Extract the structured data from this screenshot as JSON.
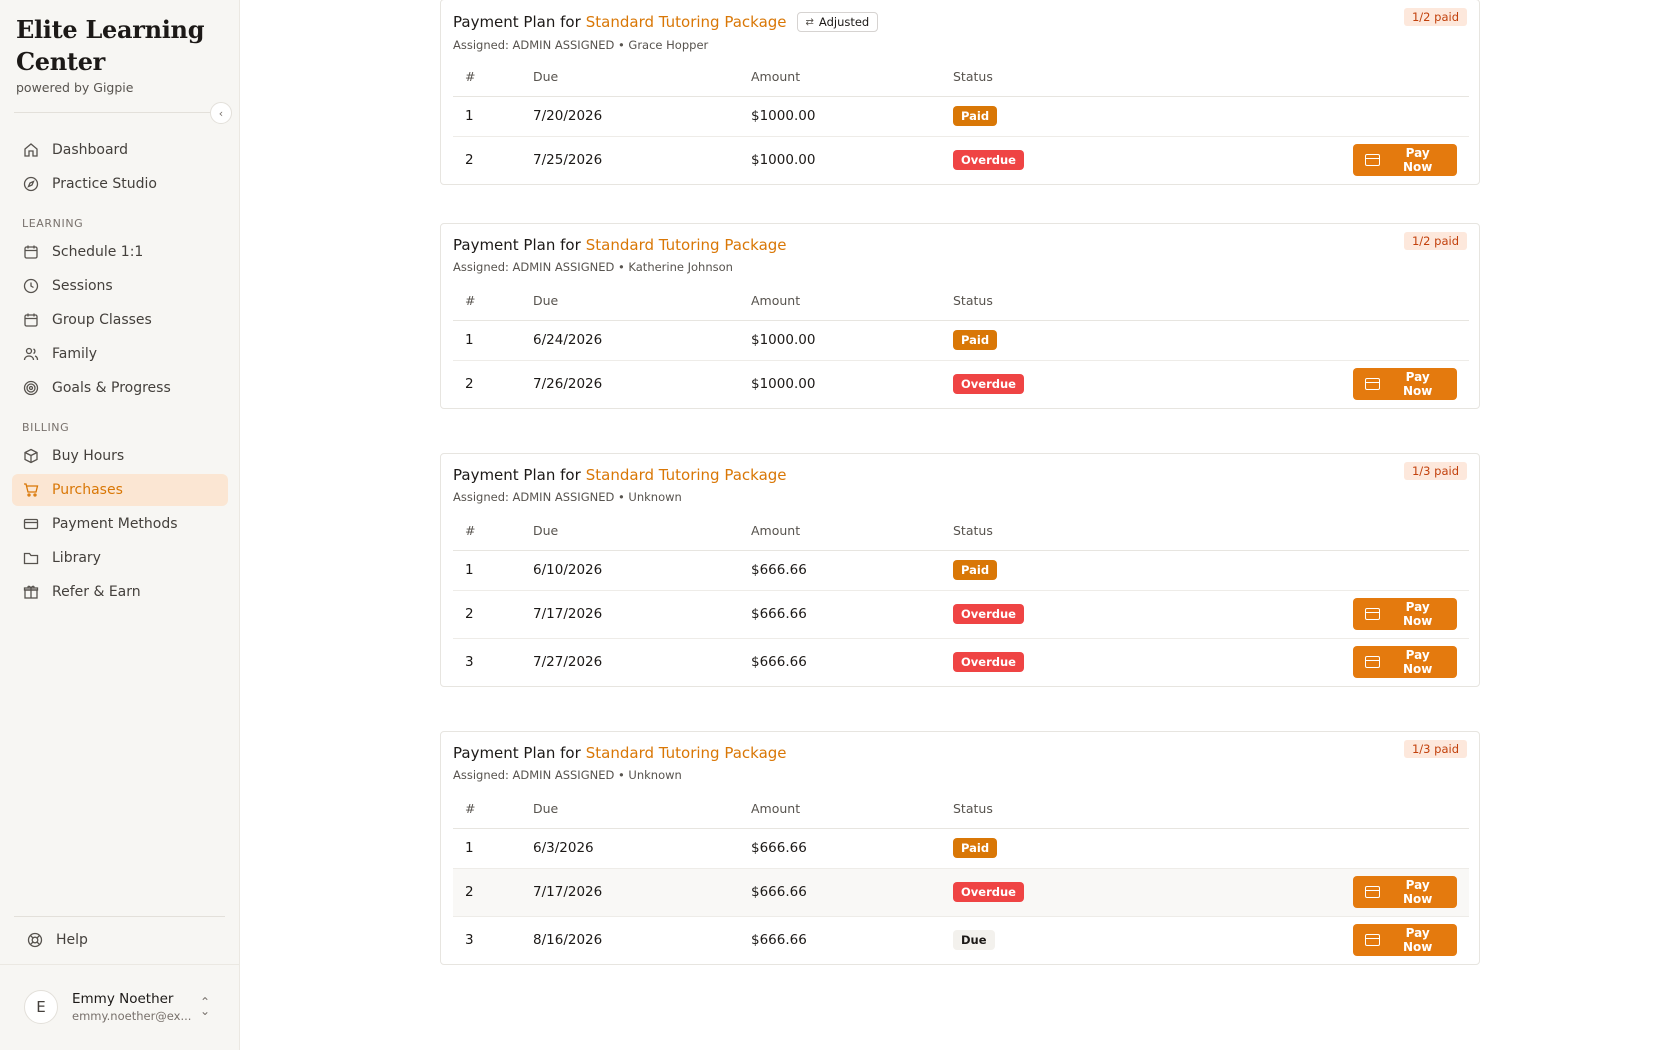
{
  "brand": {
    "name": "Elite Learning Center",
    "powered_by": "powered by Gigpie"
  },
  "nav": {
    "top": [
      {
        "label": "Dashboard",
        "icon": "home-icon"
      },
      {
        "label": "Practice Studio",
        "icon": "compass-icon"
      }
    ],
    "learning_title": "LEARNING",
    "learning": [
      {
        "label": "Schedule 1:1",
        "icon": "calendar-icon"
      },
      {
        "label": "Sessions",
        "icon": "clock-icon"
      },
      {
        "label": "Group Classes",
        "icon": "calendar-icon"
      },
      {
        "label": "Family",
        "icon": "users-icon"
      },
      {
        "label": "Goals & Progress",
        "icon": "target-icon"
      }
    ],
    "billing_title": "BILLING",
    "billing": [
      {
        "label": "Buy Hours",
        "icon": "package-icon"
      },
      {
        "label": "Purchases",
        "icon": "cart-icon",
        "active": true
      },
      {
        "label": "Payment Methods",
        "icon": "credit-card-icon"
      },
      {
        "label": "Library",
        "icon": "folder-icon"
      },
      {
        "label": "Refer & Earn",
        "icon": "gift-icon"
      }
    ],
    "help": "Help"
  },
  "user": {
    "initial": "E",
    "name": "Emmy Noether",
    "email": "emmy.noether@ex..."
  },
  "table_headers": {
    "num": "#",
    "due": "Due",
    "amount": "Amount",
    "status": "Status"
  },
  "plans": [
    {
      "title_prefix": "Payment Plan for",
      "package": "Standard Tutoring Package",
      "adjusted": "Adjusted",
      "assigned": "Assigned: ADMIN ASSIGNED • Grace Hopper",
      "paid_badge": "1/2 paid",
      "rows": [
        {
          "num": "1",
          "due": "7/20/2026",
          "amount": "$1000.00",
          "status": "Paid"
        },
        {
          "num": "2",
          "due": "7/25/2026",
          "amount": "$1000.00",
          "status": "Overdue",
          "action": "Pay Now"
        }
      ]
    },
    {
      "title_prefix": "Payment Plan for",
      "package": "Standard Tutoring Package",
      "assigned": "Assigned: ADMIN ASSIGNED • Katherine Johnson",
      "paid_badge": "1/2 paid",
      "rows": [
        {
          "num": "1",
          "due": "6/24/2026",
          "amount": "$1000.00",
          "status": "Paid"
        },
        {
          "num": "2",
          "due": "7/26/2026",
          "amount": "$1000.00",
          "status": "Overdue",
          "action": "Pay Now"
        }
      ]
    },
    {
      "title_prefix": "Payment Plan for",
      "package": "Standard Tutoring Package",
      "assigned": "Assigned: ADMIN ASSIGNED • Unknown",
      "paid_badge": "1/3 paid",
      "rows": [
        {
          "num": "1",
          "due": "6/10/2026",
          "amount": "$666.66",
          "status": "Paid"
        },
        {
          "num": "2",
          "due": "7/17/2026",
          "amount": "$666.66",
          "status": "Overdue",
          "action": "Pay Now"
        },
        {
          "num": "3",
          "due": "7/27/2026",
          "amount": "$666.66",
          "status": "Overdue",
          "action": "Pay Now"
        }
      ]
    },
    {
      "title_prefix": "Payment Plan for",
      "package": "Standard Tutoring Package",
      "assigned": "Assigned: ADMIN ASSIGNED • Unknown",
      "paid_badge": "1/3 paid",
      "rows": [
        {
          "num": "1",
          "due": "6/3/2026",
          "amount": "$666.66",
          "status": "Paid"
        },
        {
          "num": "2",
          "due": "7/17/2026",
          "amount": "$666.66",
          "status": "Overdue",
          "action": "Pay Now"
        },
        {
          "num": "3",
          "due": "8/16/2026",
          "amount": "$666.66",
          "status": "Due",
          "action": "Pay Now"
        }
      ]
    }
  ],
  "colors": {
    "accent": "#d97706",
    "overdue": "#ef4444",
    "active_nav_bg": "#fbe6d3"
  }
}
